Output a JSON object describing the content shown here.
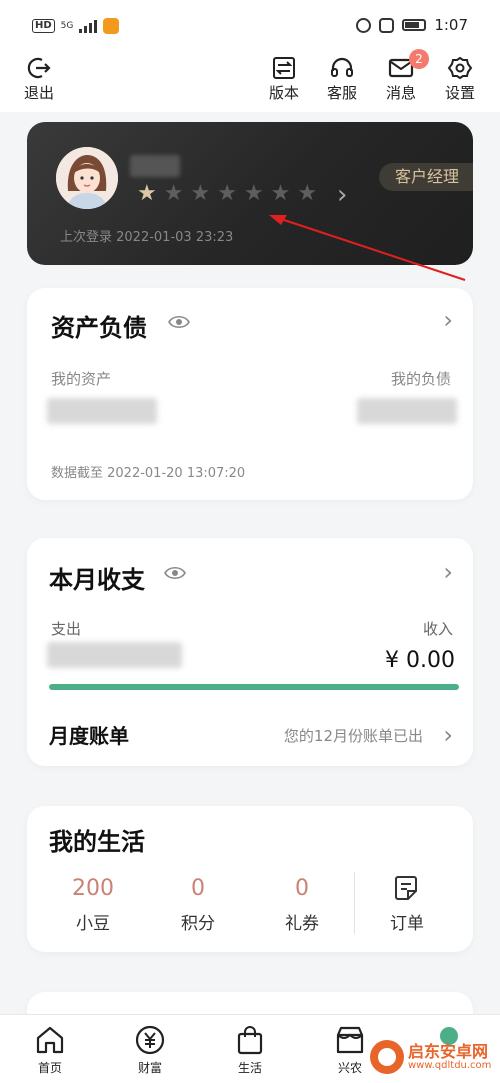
{
  "status_bar": {
    "left_badge": "HD",
    "network": "5G",
    "time": "1:07"
  },
  "header": {
    "logout": "退出",
    "version": "版本",
    "service": "客服",
    "messages": "消息",
    "messages_badge": "2",
    "settings": "设置"
  },
  "profile": {
    "stars_total": 7,
    "stars_filled": 1,
    "manager_tag": "客户经理",
    "last_login": "上次登录 2022-01-03 23:23"
  },
  "assets": {
    "title": "资产负债",
    "my_assets": "我的资产",
    "my_liabilities": "我的负债",
    "data_as_of": "数据截至 2022-01-20 13:07:20"
  },
  "monthly": {
    "title": "本月收支",
    "expense_label": "支出",
    "income_label": "收入",
    "income_value": "¥ 0.00",
    "progress_color": "#4caf87",
    "bill_title": "月度账单",
    "bill_status": "您的12月份账单已出"
  },
  "life": {
    "title": "我的生活",
    "items": [
      {
        "value": "200",
        "label": "小豆"
      },
      {
        "value": "0",
        "label": "积分"
      },
      {
        "value": "0",
        "label": "礼券"
      }
    ],
    "orders_label": "订单"
  },
  "bottom_nav": [
    {
      "label": "首页"
    },
    {
      "label": "财富"
    },
    {
      "label": "生活"
    },
    {
      "label": "兴农"
    }
  ],
  "watermark": {
    "title": "启东安卓网",
    "url": "www.qdltdu.com"
  },
  "colors": {
    "accent": "#4caf87",
    "highlight": "#c98274",
    "badge": "#f47a6e"
  }
}
